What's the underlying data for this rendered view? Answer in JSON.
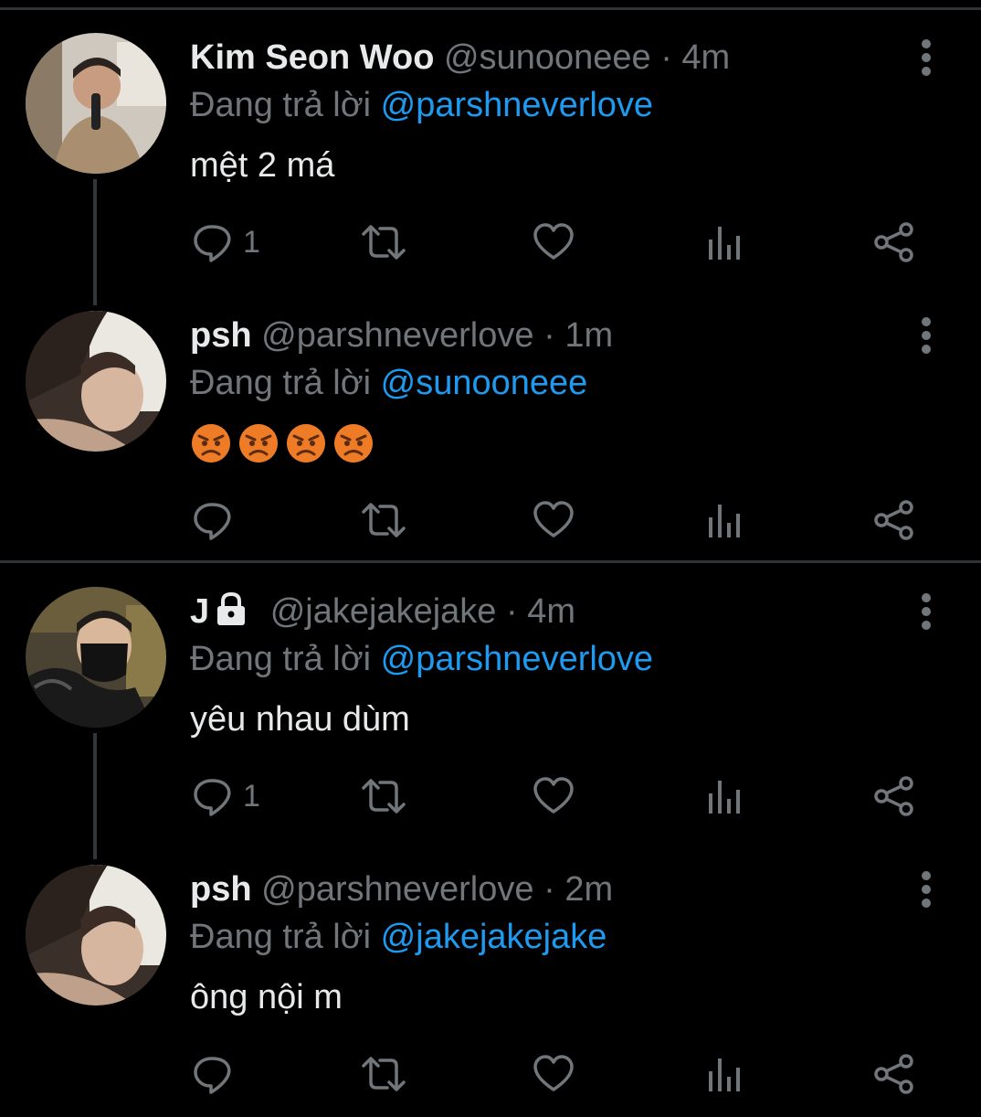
{
  "theme": {
    "background": "#000000",
    "text": "#e7e9ea",
    "muted": "#71767b",
    "accent": "#1d9bf0",
    "divider": "#2f3336"
  },
  "reply_prefix": "Đang trả lời",
  "tweets": [
    {
      "name": "Kim Seon Woo",
      "handle": "@sunooneee",
      "dot": "·",
      "time": "4m",
      "reply_to": "@parshneverlove",
      "text": "mệt 2 má",
      "reply_count": "1",
      "locked": false
    },
    {
      "name": "psh",
      "handle": "@parshneverlove",
      "dot": "·",
      "time": "1m",
      "reply_to": "@sunooneee",
      "text": "",
      "emojis": [
        "angry-face",
        "angry-face",
        "angry-face",
        "angry-face"
      ],
      "reply_count": "",
      "locked": false
    },
    {
      "name": "J",
      "handle": "@jakejakejake",
      "dot": "·",
      "time": "4m",
      "reply_to": "@parshneverlove",
      "text": "yêu nhau dùm",
      "reply_count": "1",
      "locked": true
    },
    {
      "name": "psh",
      "handle": "@parshneverlove",
      "dot": "·",
      "time": "2m",
      "reply_to": "@jakejakejake",
      "text": "ông nội m",
      "reply_count": "",
      "locked": false
    }
  ],
  "icons": {
    "reply": "reply-icon",
    "retweet": "retweet-icon",
    "like": "heart-icon",
    "views": "views-icon",
    "share": "share-icon",
    "more": "more-vertical-icon",
    "lock": "lock-icon"
  }
}
